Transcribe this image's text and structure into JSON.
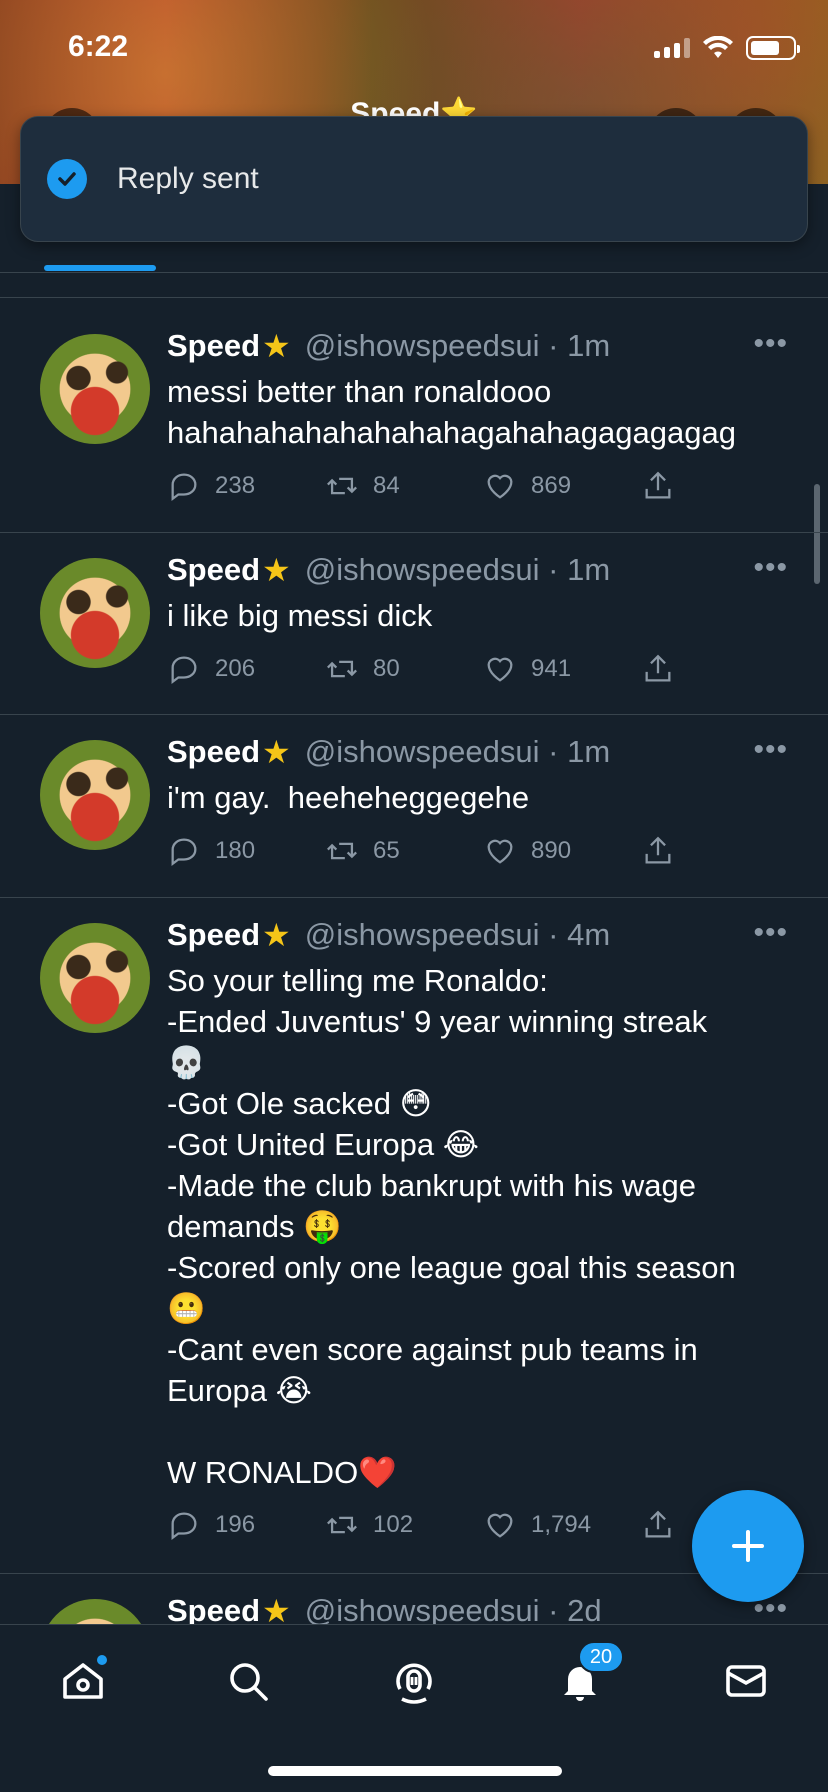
{
  "status_bar": {
    "time": "6:22"
  },
  "profile": {
    "title": "Speed⭐"
  },
  "toast": {
    "text": "Reply sent"
  },
  "tweets": [
    {
      "name": "Speed",
      "handle": "@ishowspeedsui · 1m",
      "body": "messi better than ronaldooo\nhahahahahahahahahagahahagagagagag",
      "replies": "238",
      "retweets": "84",
      "likes": "869"
    },
    {
      "name": "Speed",
      "handle": "@ishowspeedsui · 1m",
      "body": "i like big messi dick",
      "replies": "206",
      "retweets": "80",
      "likes": "941"
    },
    {
      "name": "Speed",
      "handle": "@ishowspeedsui · 1m",
      "body": "i'm gay.  heeheheggegehe",
      "replies": "180",
      "retweets": "65",
      "likes": "890"
    },
    {
      "name": "Speed",
      "handle": "@ishowspeedsui · 4m",
      "body": "So your telling me Ronaldo:\n-Ended Juventus' 9 year winning streak\n💀\n-Got Ole sacked 😳\n-Got United Europa 😂\n-Made the club bankrupt with his wage\ndemands 🤑\n-Scored only one league goal this season\n😬\n-Cant even score against pub teams in\nEuropa 😭\n\nW RONALDO❤️",
      "replies": "196",
      "retweets": "102",
      "likes": "1,794"
    },
    {
      "name": "Speed",
      "handle": "@ishowspeedsui · 2d"
    }
  ],
  "nav": {
    "notifications_badge": "20"
  },
  "colors": {
    "background": "#15202b",
    "accent": "#1d9bf0",
    "divider": "#38444d",
    "secondary_text": "#8b98a5"
  }
}
